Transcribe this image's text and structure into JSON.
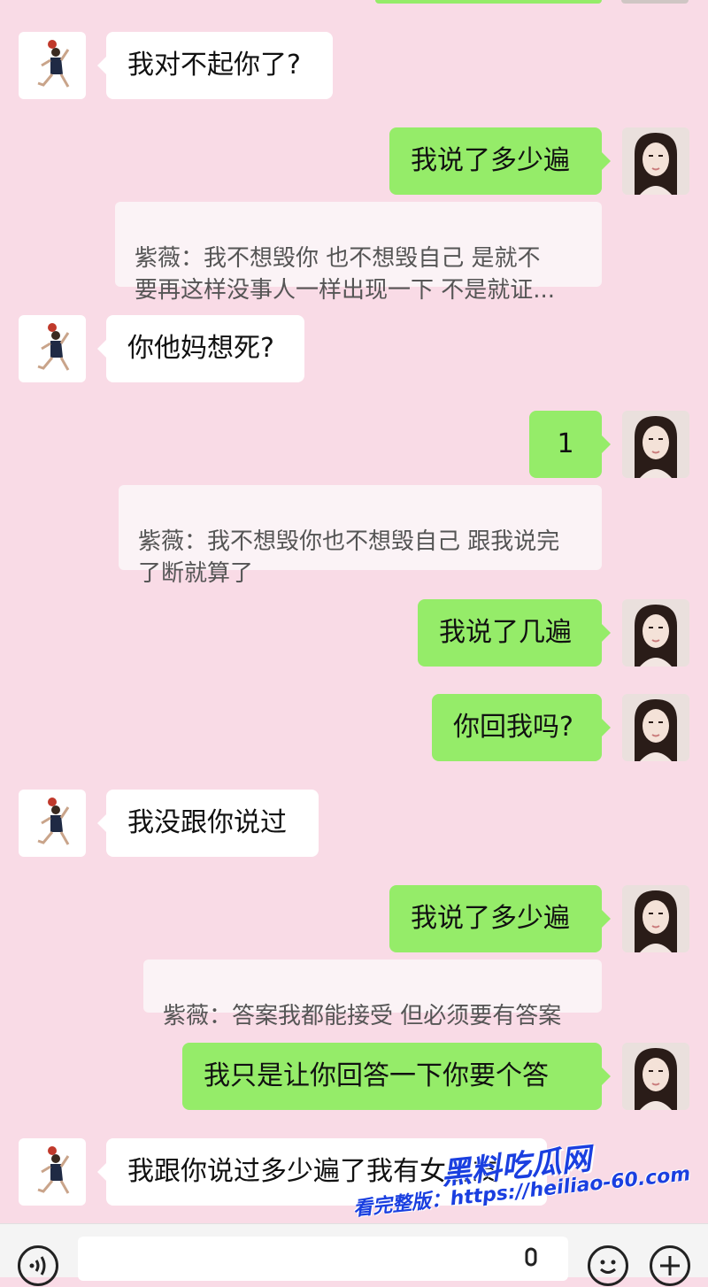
{
  "messages": [
    {
      "side": "in",
      "text": "我对不起你了?"
    },
    {
      "side": "out",
      "text": "我说了多少遍"
    },
    {
      "quote": "紫薇：我不想毁你 也不想毁自己  是就不\n要再这样没事人一样出现一下  不是就证..."
    },
    {
      "side": "in",
      "text": "你他妈想死?"
    },
    {
      "side": "out",
      "text": "1"
    },
    {
      "quote": "紫薇：我不想毁你也不想毁自己 跟我说完\n了断就算了"
    },
    {
      "side": "out",
      "text": "我说了几遍"
    },
    {
      "side": "out",
      "text": "你回我吗?"
    },
    {
      "side": "in",
      "text": "我没跟你说过"
    },
    {
      "side": "out",
      "text": "我说了多少遍"
    },
    {
      "quote": "紫薇：答案我都能接受 但必须要有答案"
    },
    {
      "side": "out",
      "text": "我只是让你回答一下你要个答"
    },
    {
      "side": "in",
      "text": "我跟你说过多少遍了我有女朋友"
    }
  ],
  "watermark": {
    "title": "黑料吃瓜网",
    "url_line": "看完整版：https://heiliao-60.com"
  },
  "input_bar": {
    "icons": [
      "voice-icon",
      "microphone-icon",
      "emoji-icon",
      "plus-icon"
    ]
  }
}
